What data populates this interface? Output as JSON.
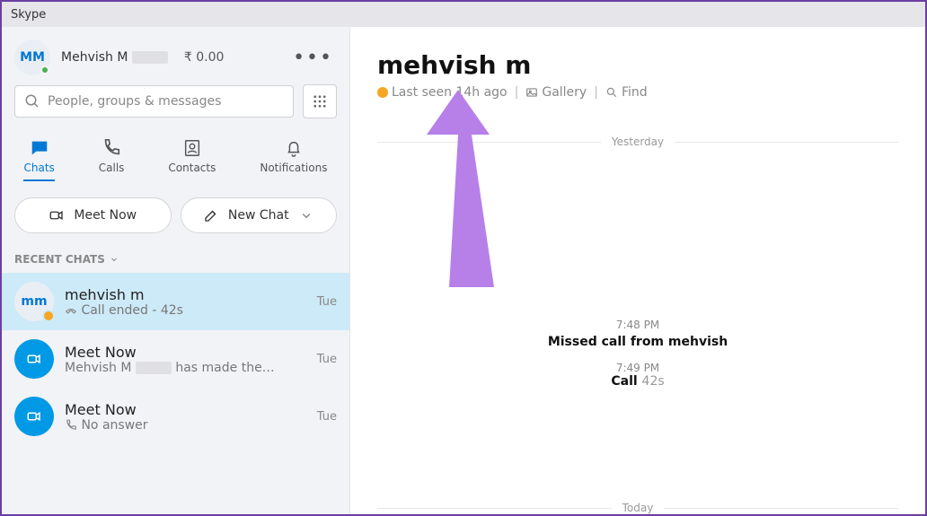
{
  "titlebar": "Skype",
  "profile": {
    "initials": "MM",
    "name": "Mehvish M",
    "credit": "₹ 0.00"
  },
  "search": {
    "placeholder": "People, groups & messages"
  },
  "tabs": [
    {
      "label": "Chats"
    },
    {
      "label": "Calls"
    },
    {
      "label": "Contacts"
    },
    {
      "label": "Notifications"
    }
  ],
  "buttons": {
    "meet_now": "Meet Now",
    "new_chat": "New Chat"
  },
  "section_header": "RECENT CHATS",
  "chats": [
    {
      "avatar_text": "mm",
      "title": "mehvish m",
      "sub_prefix": "",
      "sub": "Call ended - 42s",
      "time": "Tue"
    },
    {
      "title": "Meet Now",
      "sub_name": "Mehvish M",
      "sub_rest": "has made the…",
      "time": "Tue"
    },
    {
      "title": "Meet Now",
      "sub": "No answer",
      "time": "Tue"
    }
  ],
  "conversation": {
    "title": "mehvish m",
    "last_seen": "Last seen 14h ago",
    "gallery": "Gallery",
    "find": "Find",
    "divider1": "Yesterday",
    "divider2": "Today",
    "events": [
      {
        "time": "7:48 PM",
        "text": "Missed call from mehvish"
      },
      {
        "time": "7:49 PM",
        "label": "Call",
        "dur": "42s"
      }
    ]
  }
}
